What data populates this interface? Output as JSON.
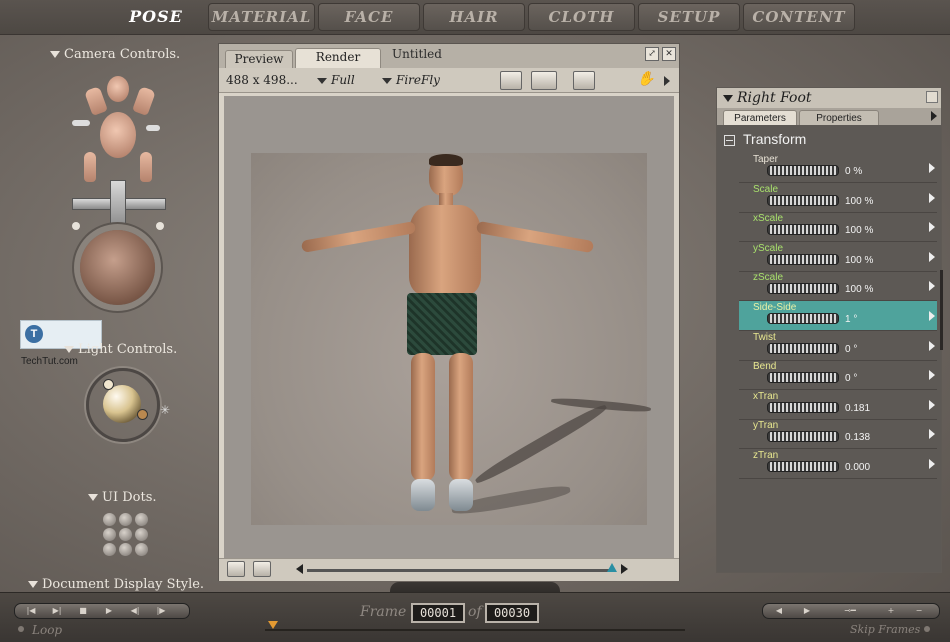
{
  "nav": {
    "tabs": [
      "POSE",
      "MATERIAL",
      "FACE",
      "HAIR",
      "CLOTH",
      "SETUP",
      "CONTENT"
    ],
    "active": "POSE"
  },
  "left_panel": {
    "camera_controls": "Camera Controls.",
    "light_controls": "Light Controls.",
    "ui_dots": "UI Dots.",
    "document_display_style": "Document Display Style."
  },
  "watermark": {
    "logo_letter": "T",
    "text": "TechTut.com"
  },
  "document": {
    "tabs": [
      "Preview",
      "Render"
    ],
    "active_tab": "Render",
    "title": "Untitled",
    "size": "488 x 498...",
    "quality": "Full",
    "renderer": "FireFly"
  },
  "parameters": {
    "title": "Right Foot",
    "tabs": [
      "Parameters",
      "Properties"
    ],
    "active_tab": "Parameters",
    "group": "Transform",
    "rows": [
      {
        "name": "Taper",
        "value": "0 %",
        "color": "#e8e2d6"
      },
      {
        "name": "Scale",
        "value": "100 %",
        "color": "#a8e06c"
      },
      {
        "name": "xScale",
        "value": "100 %",
        "color": "#a8e06c"
      },
      {
        "name": "yScale",
        "value": "100 %",
        "color": "#a8e06c"
      },
      {
        "name": "zScale",
        "value": "100 %",
        "color": "#a8e06c"
      },
      {
        "name": "Side-Side",
        "value": "1 °",
        "color": "#e8f0a6",
        "selected": true
      },
      {
        "name": "Twist",
        "value": "0 °",
        "color": "#e8e890"
      },
      {
        "name": "Bend",
        "value": "0 °",
        "color": "#e8e890"
      },
      {
        "name": "xTran",
        "value": "0.181",
        "color": "#e8e890"
      },
      {
        "name": "yTran",
        "value": "0.138",
        "color": "#e8e890"
      },
      {
        "name": "zTran",
        "value": "0.000",
        "color": "#e8e890"
      }
    ]
  },
  "timeline": {
    "frame_label": "Frame",
    "of_label": "of",
    "current_frame": "00001",
    "total_frames": "00030",
    "loop_label": "Loop",
    "skip_frames_label": "Skip Frames"
  },
  "colors": {
    "selected_row": "#4fa39c",
    "timeline_knob": "#e39a32",
    "slider_knob": "#2a8fa3"
  }
}
